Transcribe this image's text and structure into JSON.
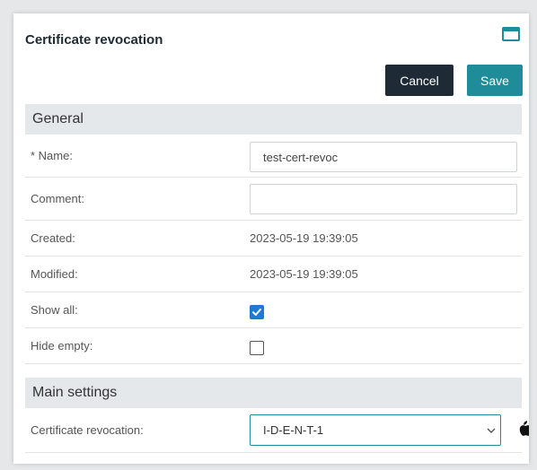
{
  "dialog": {
    "title": "Certificate revocation",
    "cancel_label": "Cancel",
    "save_label": "Save",
    "icons": {
      "window": "window-maximize-icon",
      "platform": "apple-icon"
    }
  },
  "general": {
    "heading": "General",
    "name": {
      "label": "* Name:",
      "value": "test-cert-revoc"
    },
    "comment": {
      "label": "Comment:",
      "value": ""
    },
    "created": {
      "label": "Created:",
      "value": "2023-05-19 19:39:05"
    },
    "modified": {
      "label": "Modified:",
      "value": "2023-05-19 19:39:05"
    },
    "show_all": {
      "label": "Show all:",
      "checked": true
    },
    "hide_empty": {
      "label": "Hide empty:",
      "checked": false
    }
  },
  "main_settings": {
    "heading": "Main settings",
    "certificate_revocation": {
      "label": "Certificate revocation:",
      "selected": "I-D-E-N-T-1"
    }
  },
  "colors": {
    "accent": "#1f8c9a",
    "cancel_bg": "#1e2a36",
    "checkbox": "#1f7ad1",
    "section_bg": "#e5e8eb"
  }
}
